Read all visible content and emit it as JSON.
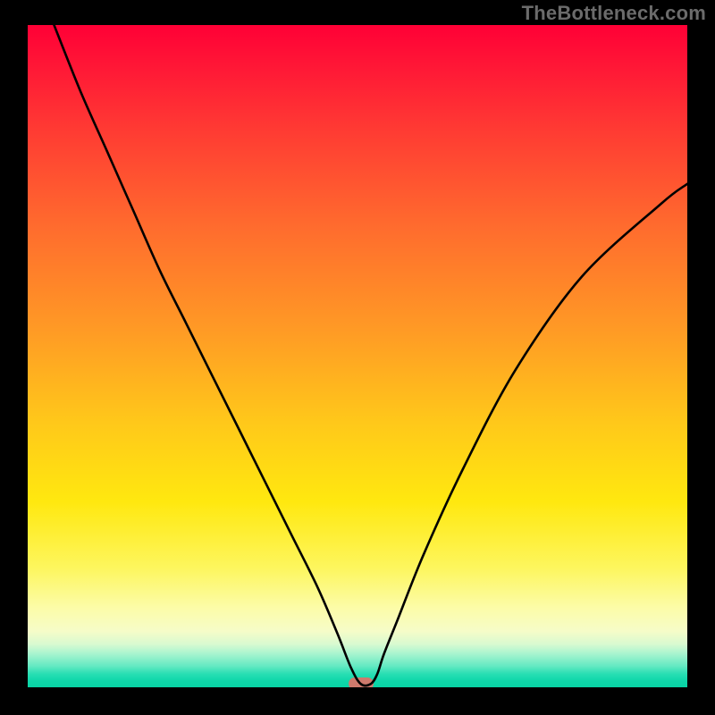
{
  "watermark": "TheBottleneck.com",
  "chart_data": {
    "type": "line",
    "title": "",
    "xlabel": "",
    "ylabel": "",
    "xlim": [
      0,
      100
    ],
    "ylim": [
      0,
      100
    ],
    "grid": false,
    "series": [
      {
        "name": "curve",
        "x": [
          4,
          8,
          12,
          16,
          20,
          24,
          28,
          32,
          36,
          40,
          44,
          47,
          49,
          50.5,
          52,
          53,
          54,
          56,
          60,
          66,
          74,
          84,
          96,
          100
        ],
        "y": [
          100,
          90,
          81,
          72,
          63,
          55,
          47,
          39,
          31,
          23,
          15,
          8,
          3,
          0.5,
          0.5,
          2,
          5,
          10,
          20,
          33,
          48,
          62,
          73,
          76
        ]
      }
    ],
    "marker": {
      "x": 50.5,
      "y": 0.5
    },
    "background_gradient": {
      "top": "#ff0036",
      "mid": "#ffe80f",
      "bottom": "#08d3a4"
    }
  }
}
